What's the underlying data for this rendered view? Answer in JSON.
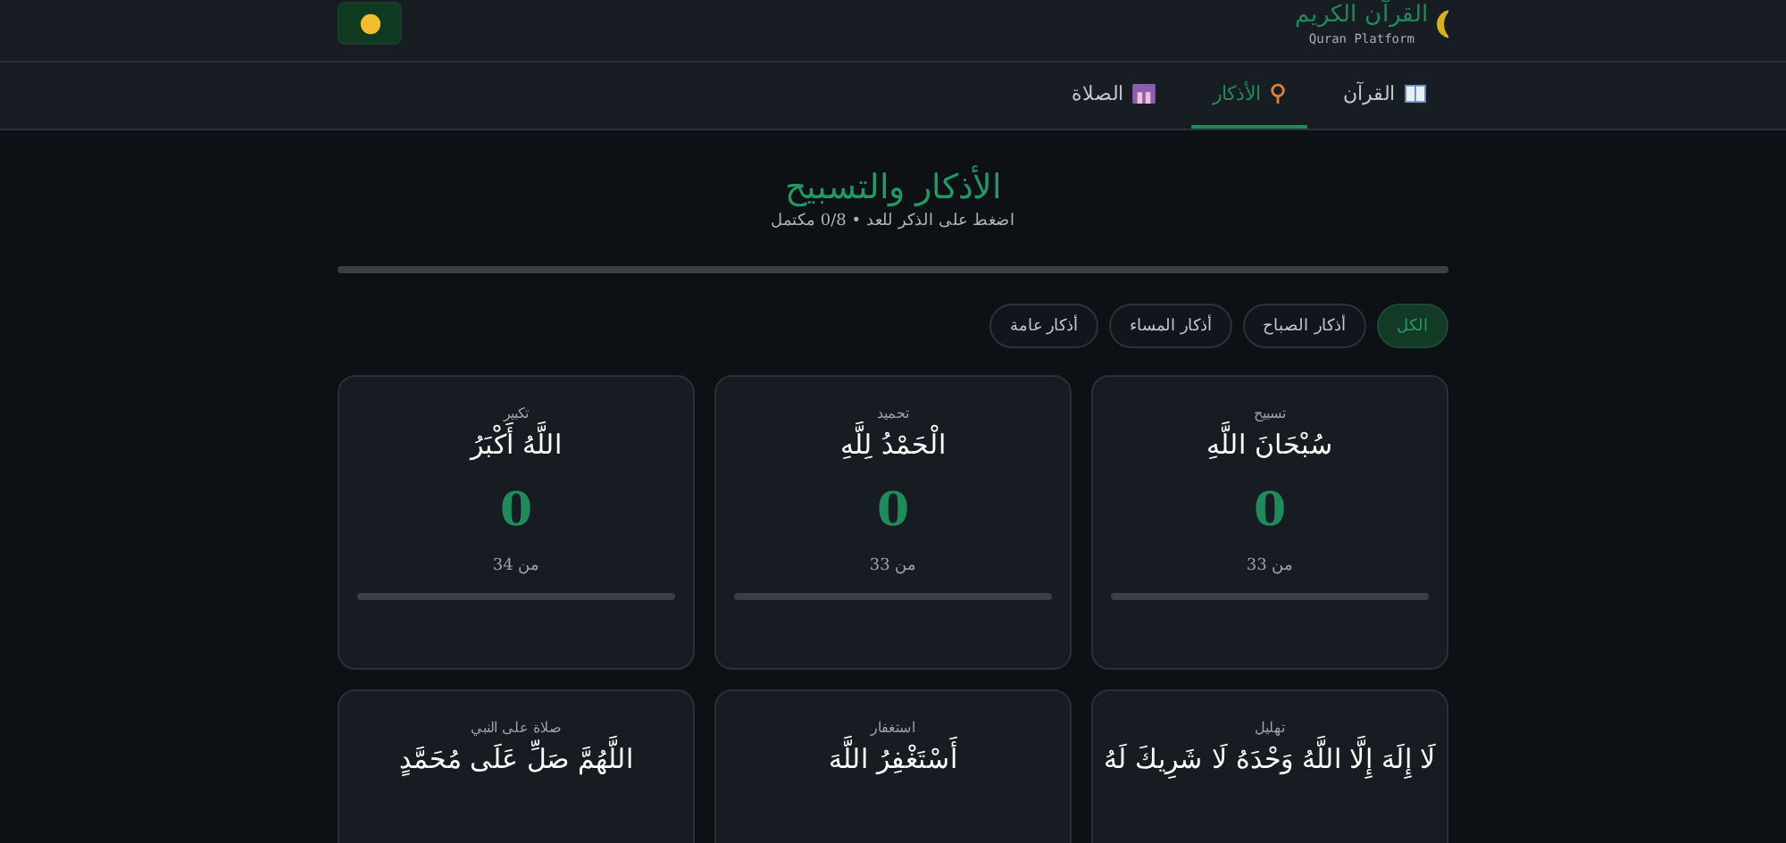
{
  "header": {
    "logo_title": "القرآن الكريم",
    "logo_subtitle": "Quran Platform"
  },
  "nav_tabs": [
    {
      "label": "القرآن",
      "selected": false
    },
    {
      "label": "الأذكار",
      "selected": true
    },
    {
      "label": "الصلاة",
      "selected": false
    }
  ],
  "page": {
    "title": "الأذكار والتسبيح",
    "subtitle": "اضغط على الذكر للعد • 0/8 مكتمل",
    "progress": {
      "level": 0
    }
  },
  "filters": [
    {
      "label": "الكل",
      "selected": true
    },
    {
      "label": "أذكار الصباح",
      "selected": false
    },
    {
      "label": "أذكار المساء",
      "selected": false
    },
    {
      "label": "أذكار عامة",
      "selected": false
    }
  ],
  "cards": [
    {
      "category": "تسبيح",
      "text": "سُبْحَانَ اللَّهِ",
      "count": "0",
      "target": "من 33",
      "level": 0
    },
    {
      "category": "تحميد",
      "text": "الْحَمْدُ لِلَّهِ",
      "count": "0",
      "target": "من 33",
      "level": 0
    },
    {
      "category": "تكبير",
      "text": "اللَّهُ أَكْبَرُ",
      "count": "0",
      "target": "من 34",
      "level": 0
    },
    {
      "category": "تهليل",
      "text": "لَا إِلَهَ إِلَّا اللَّهُ وَحْدَهُ لَا شَرِيكَ لَهُ"
    },
    {
      "category": "استغفار",
      "text": "أَسْتَغْفِرُ اللَّهَ"
    },
    {
      "category": "صلاة على النبي",
      "text": "اللَّهُمَّ صَلِّ عَلَى مُحَمَّدٍ"
    }
  ]
}
